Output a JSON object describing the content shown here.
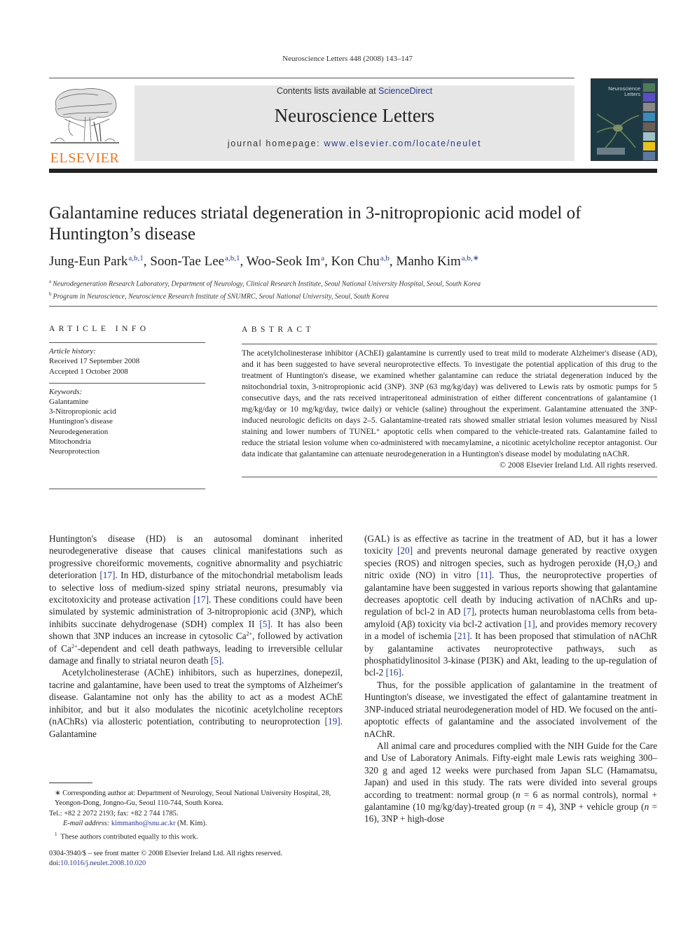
{
  "running_head": "Neuroscience Letters 448 (2008) 143–147",
  "header": {
    "publisher_logo_text": "ELSEVIER",
    "contents_prefix": "Contents lists available at ",
    "contents_link": "ScienceDirect",
    "journal_title": "Neuroscience Letters",
    "homepage_prefix": "journal homepage: ",
    "homepage_link": "www.elsevier.com/locate/neulet",
    "cover_title_line1": "Neuroscience",
    "cover_title_line2": "Letters",
    "colors": {
      "publisher_orange": "#e87722",
      "link_blue": "#2a3a8c",
      "banner_gray": "#e6e6e6"
    }
  },
  "article": {
    "title": "Galantamine reduces striatal degeneration in 3-nitropropionic acid model of Huntington’s disease",
    "authors": [
      {
        "name": "Jung-Eun Park",
        "marks": "a,b,1",
        "sep": ", "
      },
      {
        "name": "Soon-Tae Lee",
        "marks": "a,b,1",
        "sep": ", "
      },
      {
        "name": "Woo-Seok Im",
        "marks": "a",
        "sep": ", "
      },
      {
        "name": "Kon Chu",
        "marks": "a,b",
        "sep": ", "
      },
      {
        "name": "Manho Kim",
        "marks": "a,b,∗",
        "sep": ""
      }
    ],
    "affiliations": [
      {
        "mark": "a",
        "text": "Neurodegeneration Research Laboratory, Department of Neurology, Clinical Research Institute, Seoul National University Hospital, Seoul, South Korea"
      },
      {
        "mark": "b",
        "text": "Program in Neuroscience, Neuroscience Research Institute of SNUMRC, Seoul National University, Seoul, South Korea"
      }
    ]
  },
  "article_info": {
    "heading": "ARTICLE INFO",
    "history_label": "Article history:",
    "received": "Received 17 September 2008",
    "accepted": "Accepted 1 October 2008",
    "keywords_label": "Keywords:",
    "keywords": [
      "Galantamine",
      "3-Nitropropionic acid",
      "Huntington's disease",
      "Neurodegeneration",
      "Mitochondria",
      "Neuroprotection"
    ]
  },
  "abstract": {
    "heading": "ABSTRACT",
    "text": "The acetylcholinesterase inhibitor (AChEI) galantamine is currently used to treat mild to moderate Alzheimer's disease (AD), and it has been suggested to have several neuroprotective effects. To investigate the potential application of this drug to the treatment of Huntington's disease, we examined whether galantamine can reduce the striatal degeneration induced by the mitochondrial toxin, 3-nitropropionic acid (3NP). 3NP (63 mg/kg/day) was delivered to Lewis rats by osmotic pumps for 5 consecutive days, and the rats received intraperitoneal administration of either different concentrations of galantamine (1 mg/kg/day or 10 mg/kg/day, twice daily) or vehicle (saline) throughout the experiment. Galantamine attenuated the 3NP-induced neurologic deficits on days 2–5. Galantamine-treated rats showed smaller striatal lesion volumes measured by Nissl staining and lower numbers of TUNEL⁺ apoptotic cells when compared to the vehicle-treated rats. Galantamine failed to reduce the striatal lesion volume when co-administered with mecamylamine, a nicotinic acetylcholine receptor antagonist. Our data indicate that galantamine can attenuate neurodegeneration in a Huntington's disease model by modulating nAChR.",
    "copyright": "© 2008 Elsevier Ireland Ltd. All rights reserved."
  },
  "body": {
    "left_p1": {
      "s1": "Huntington's disease (HD) is an autosomal dominant inherited neurodegenerative disease that causes clinical manifestations such as progressive choreiformic movements, cognitive abnormality and psychiatric deterioration ",
      "c1": "[17]",
      "s2": ". In HD, disturbance of the mitochondrial metabolism leads to selective loss of medium-sized spiny striatal neurons, presumably via excitotoxicity and protease activation ",
      "c2": "[17]",
      "s3": ". These conditions could have been simulated by systemic administration of 3-nitropropionic acid (3NP), which inhibits succinate dehydrogenase (SDH) complex II ",
      "c3": "[5]",
      "s4": ". It has also been shown that 3NP induces an increase in cytosolic Ca",
      "sup1": "2+",
      "s5": ", followed by activation of Ca",
      "sup2": "2+",
      "s6": "-dependent and cell death pathways, leading to irreversible cellular damage and finally to striatal neuron death ",
      "c4": "[5]",
      "s7": "."
    },
    "left_p2": {
      "s1": "Acetylcholinesterase (AChE) inhibitors, such as huperzines, donepezil, tacrine and galantamine, have been used to treat the symptoms of Alzheimer's disease. Galantamine not only has the ability to act as a modest AChE inhibitor, and but it also modulates the nicotinic acetylcholine receptors (nAChRs) via allosteric potentiation, contributing to neuroprotection ",
      "c1": "[19]",
      "s2": ". Galantamine"
    },
    "right_p1": {
      "s1": "(GAL) is as effective as tacrine in the treatment of AD, but it has a lower toxicity ",
      "c1": "[20]",
      "s2": " and prevents neuronal damage generated by reactive oxygen species (ROS) and nitrogen species, such as hydrogen peroxide (H",
      "sub1": "2",
      "s2b": "O",
      "sub2": "2",
      "s3": ") and nitric oxide (NO) in vitro ",
      "c2": "[11]",
      "s4": ". Thus, the neuroprotective properties of galantamine have been suggested in various reports showing that galantamine decreases apoptotic cell death by inducing activation of nAChRs and up-regulation of bcl-2 in AD ",
      "c3": "[7]",
      "s5": ", protects human neuroblastoma cells from beta-amyloid (Aβ) toxicity via bcl-2 activation ",
      "c4": "[1]",
      "s6": ", and provides memory recovery in a model of ischemia ",
      "c5": "[21]",
      "s7": ". It has been proposed that stimulation of nAChR by galantamine activates neuroprotective pathways, such as phosphatidylinositol 3-kinase (PI3K) and Akt, leading to the up-regulation of bcl-2 ",
      "c6": "[16]",
      "s8": "."
    },
    "right_p2": "Thus, for the possible application of galantamine in the treatment of Huntington's disease, we investigated the effect of galantamine treatment in 3NP-induced striatal neurodegeneration model of HD. We focused on the anti-apoptotic effects of galantamine and the associated involvement of the nAChR.",
    "right_p3": {
      "s1": "All animal care and procedures complied with the NIH Guide for the Care and Use of Laboratory Animals. Fifty-eight male Lewis rats weighing 300–320 g and aged 12 weeks were purchased from Japan SLC (Hamamatsu, Japan) and used in this study. The rats were divided into several groups according to treatment: normal group (",
      "n": "n",
      "s2": " = 6 as normal controls), normal + galantamine (10 mg/kg/day)-treated group (",
      "s3": " = 4), 3NP + vehicle group (",
      "s4": " = 16), 3NP + high-dose"
    }
  },
  "footnotes": {
    "corresponding": "∗  Corresponding author at: Department of Neurology, Seoul National University Hospital, 28, Yeongon-Dong, Jongno-Gu, Seoul 110-744, South Korea.",
    "tel": "Tel.: +82 2 2072 2193; fax: +82 2 744 1785.",
    "email_label": "E-mail address: ",
    "email": "kimmanho@snu.ac.kr",
    "email_suffix": " (M. Kim).",
    "equal_mark": "1",
    "equal_text": "These authors contributed equally to this work."
  },
  "front_matter": {
    "issn_line": "0304-3940/$ – see front matter © 2008 Elsevier Ireland Ltd. All rights reserved.",
    "doi_prefix": "doi:",
    "doi": "10.1016/j.neulet.2008.10.020"
  }
}
